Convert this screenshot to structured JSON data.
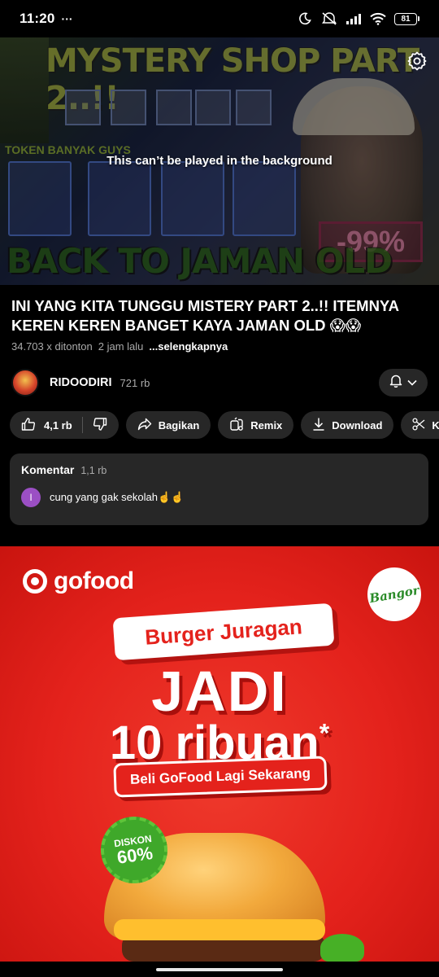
{
  "status": {
    "time": "11:20",
    "dots": "···",
    "battery": "81"
  },
  "video": {
    "thumbnail_top_text": "MYSTERY SHOP PART 2..!!",
    "thumbnail_bottom_text": "BACK TO JAMAN OLD",
    "thumbnail_token_text": "TOKEN BANYAK GUYS",
    "thumbnail_percent": "-99%",
    "background_notice": "This can’t be played in the background"
  },
  "details": {
    "title": "INI YANG KITA TUNGGU MISTERY PART 2..!! ITEMNYA KEREN KEREN BANGET KAYA JAMAN OLD 😱😱",
    "views": "34.703 x ditonton",
    "time_ago": "2 jam lalu",
    "more": "...selengkapnya"
  },
  "channel": {
    "name": "RIDOODIRI",
    "subscribers": "721 rb"
  },
  "actions": {
    "likes": "4,1 rb",
    "share": "Bagikan",
    "remix": "Remix",
    "download": "Download",
    "clip": "Klip"
  },
  "comments": {
    "title": "Komentar",
    "count": "1,1 rb",
    "top_avatar_initial": "I",
    "top_comment": "cung yang gak sekolah☝️☝️"
  },
  "ad": {
    "brand": "gofood",
    "partner_badge": "Bangor",
    "headline_pill": "Burger Juragan",
    "big_line_1": "JADI",
    "big_line_2": "10 ribuan",
    "asterisk": "*",
    "cta_pill": "Beli GoFood Lagi Sekarang",
    "discount_label": "DISKON",
    "discount_value": "60%"
  },
  "colors": {
    "background": "#000000",
    "chip": "#272727",
    "ad_red": "#e4221c",
    "discount_green": "#3fa82a"
  }
}
